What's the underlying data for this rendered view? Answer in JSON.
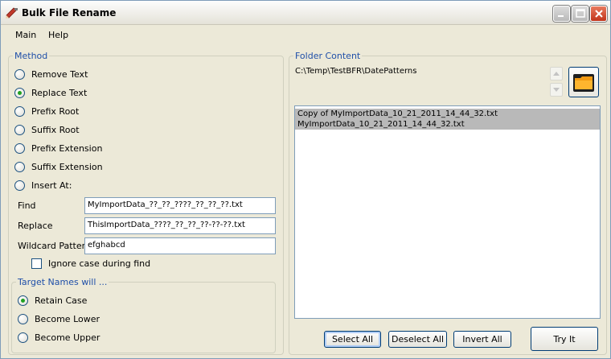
{
  "window": {
    "title": "Bulk File Rename"
  },
  "menu": {
    "items": [
      "Main",
      "Help"
    ]
  },
  "method": {
    "label": "Method",
    "options": [
      {
        "label": "Remove Text",
        "checked": false
      },
      {
        "label": "Replace Text",
        "checked": true
      },
      {
        "label": "Prefix Root",
        "checked": false
      },
      {
        "label": "Suffix Root",
        "checked": false
      },
      {
        "label": "Prefix Extension",
        "checked": false
      },
      {
        "label": "Suffix Extension",
        "checked": false
      },
      {
        "label": "Insert At:",
        "checked": false
      }
    ],
    "find_label": "Find",
    "find_value": "MyImportData_??_??_????_??_??_??.txt",
    "replace_label": "Replace",
    "replace_value": "ThisImportData_????_??_??_??-??-??.txt",
    "wildcard_label": "Wildcard Pattern",
    "wildcard_value": "efghabcd",
    "ignore_case_label": "Ignore case during find",
    "ignore_case_checked": false
  },
  "target": {
    "label": "Target Names will ...",
    "options": [
      {
        "label": "Retain Case",
        "checked": true
      },
      {
        "label": "Become Lower",
        "checked": false
      },
      {
        "label": "Become Upper",
        "checked": false
      }
    ]
  },
  "folder": {
    "label": "Folder Content",
    "path": "C:\\Temp\\TestBFR\\DatePatterns",
    "files": [
      "Copy of MyImportData_10_21_2011_14_44_32.txt",
      "MyImportData_10_21_2011_14_44_32.txt"
    ]
  },
  "buttons": {
    "select_all": "Select All",
    "deselect_all": "Deselect All",
    "invert_all": "Invert All",
    "try_it": "Try It"
  },
  "colors": {
    "group_label": "#1f4fa8",
    "selection": "#b9b9b9",
    "radio_dot": "#21a121",
    "close_button": "#c1341a"
  }
}
